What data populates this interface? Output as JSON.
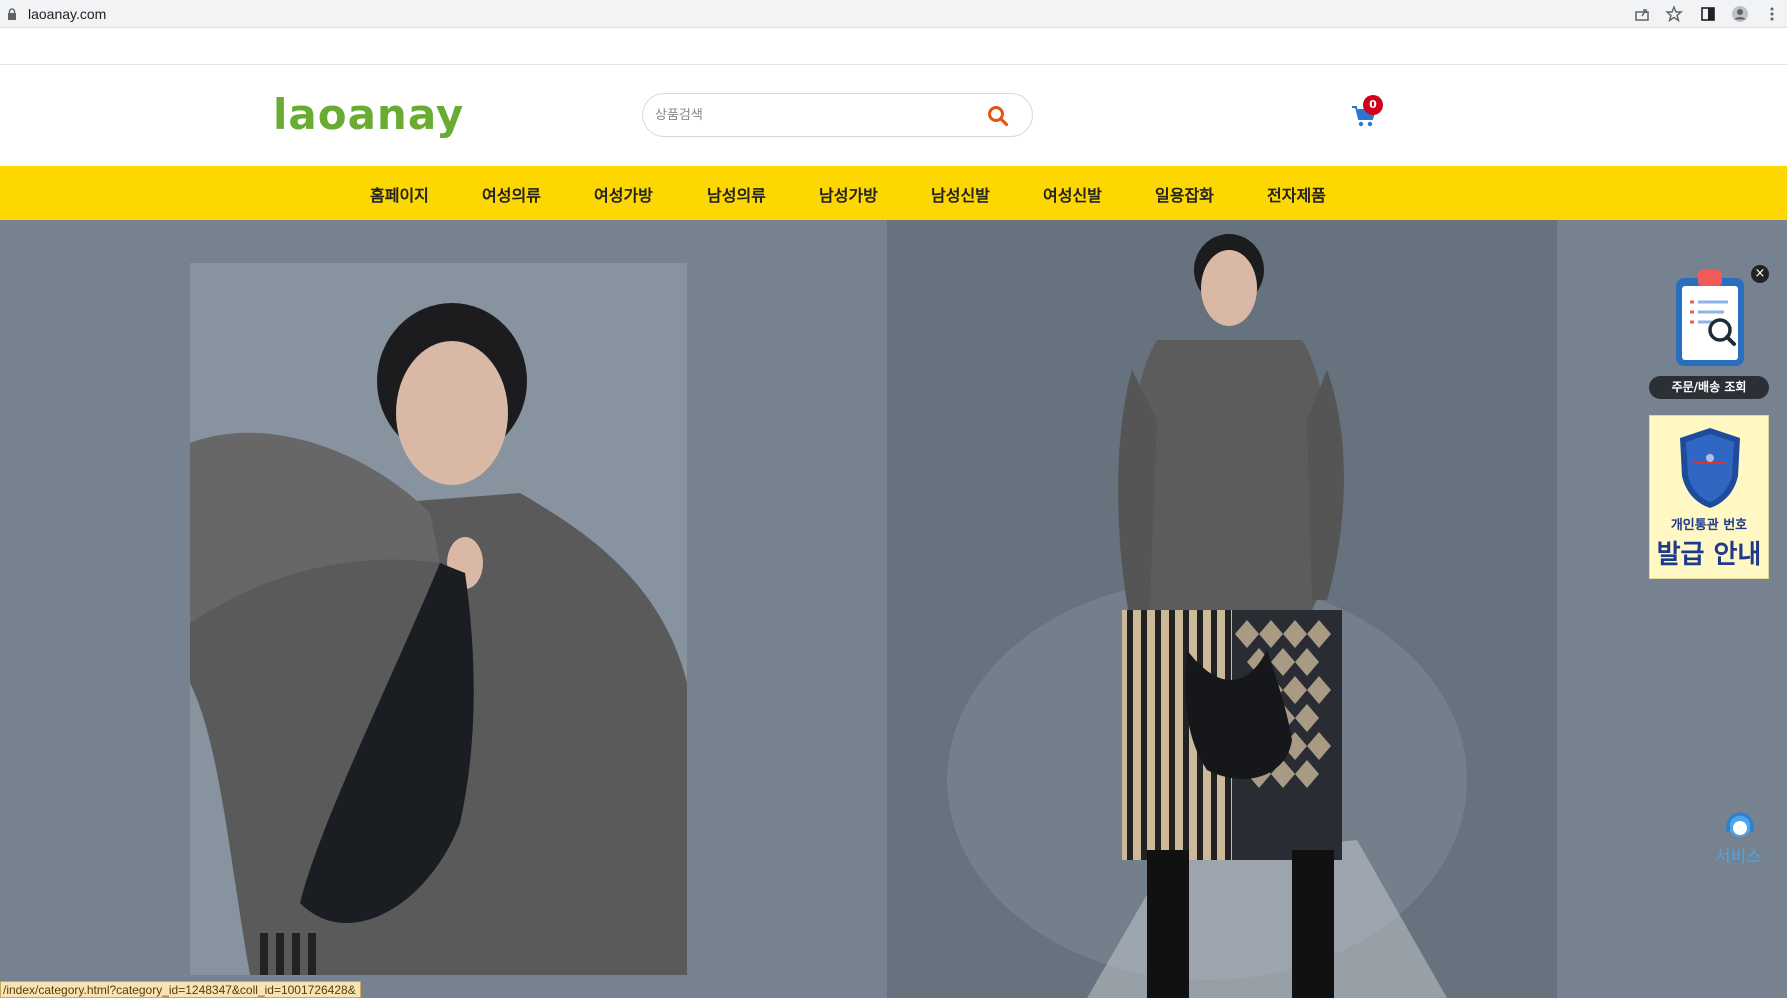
{
  "browser": {
    "url": "laoanay.com"
  },
  "header": {
    "logo": "laoanay",
    "search_placeholder": "상품검색",
    "cart_count": "0"
  },
  "nav": {
    "items": [
      "홈페이지",
      "여성의류",
      "여성가방",
      "남성의류",
      "남성가방",
      "남성신발",
      "여성신발",
      "일용잡화",
      "전자제품"
    ]
  },
  "colors": {
    "nav_bg": "#fdd700",
    "logo": "#6aab32",
    "search_icon": "#e2560f",
    "cart_icon": "#2b76d4",
    "cart_badge": "#d0021b"
  },
  "widgets": {
    "order_label": "주문/배송 조회",
    "customs_line1": "개인통관 번호",
    "customs_line2": "발급 안내",
    "service_label": "서비스"
  },
  "status_bar": {
    "url": "/index/category.html?category_id=1248347&coll_id=1001726428&"
  }
}
